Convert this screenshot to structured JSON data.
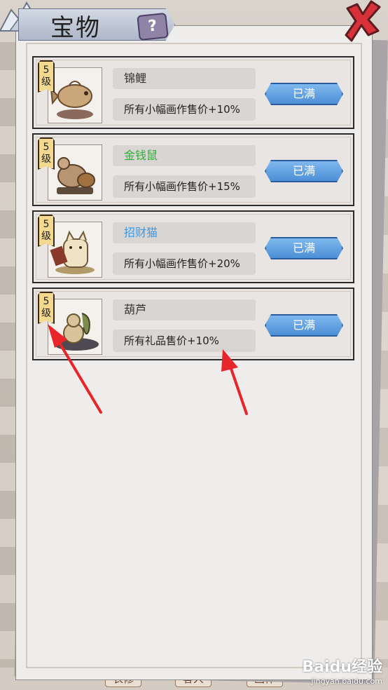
{
  "header": {
    "title": "宝物",
    "help_glyph": "?"
  },
  "items": [
    {
      "level": "5\n级",
      "name": "锦鲤",
      "name_color": "#333333",
      "effect": "所有小幅画作售价+10%",
      "button": "已满",
      "art": "koi-statue"
    },
    {
      "level": "5\n级",
      "name": "金钱鼠",
      "name_color": "#2fae3a",
      "effect": "所有小幅画作售价+15%",
      "button": "已满",
      "art": "money-rat-statue"
    },
    {
      "level": "5\n级",
      "name": "招财猫",
      "name_color": "#3b9ae6",
      "effect": "所有小幅画作售价+20%",
      "button": "已满",
      "art": "lucky-cat-statue"
    },
    {
      "level": "5\n级",
      "name": "葫芦",
      "name_color": "#333333",
      "effect": "所有礼品售价+10%",
      "button": "已满",
      "art": "gourd-statue"
    }
  ],
  "bottom_tabs": [
    "衣修",
    "客人",
    "画作"
  ],
  "watermark": {
    "logo": "Baidu经验",
    "url": "jingyan.baidu.com"
  },
  "colors": {
    "button_blue": "#4c8fd5",
    "level_gold": "#f2d98f",
    "annotation_red": "#e8262a"
  }
}
